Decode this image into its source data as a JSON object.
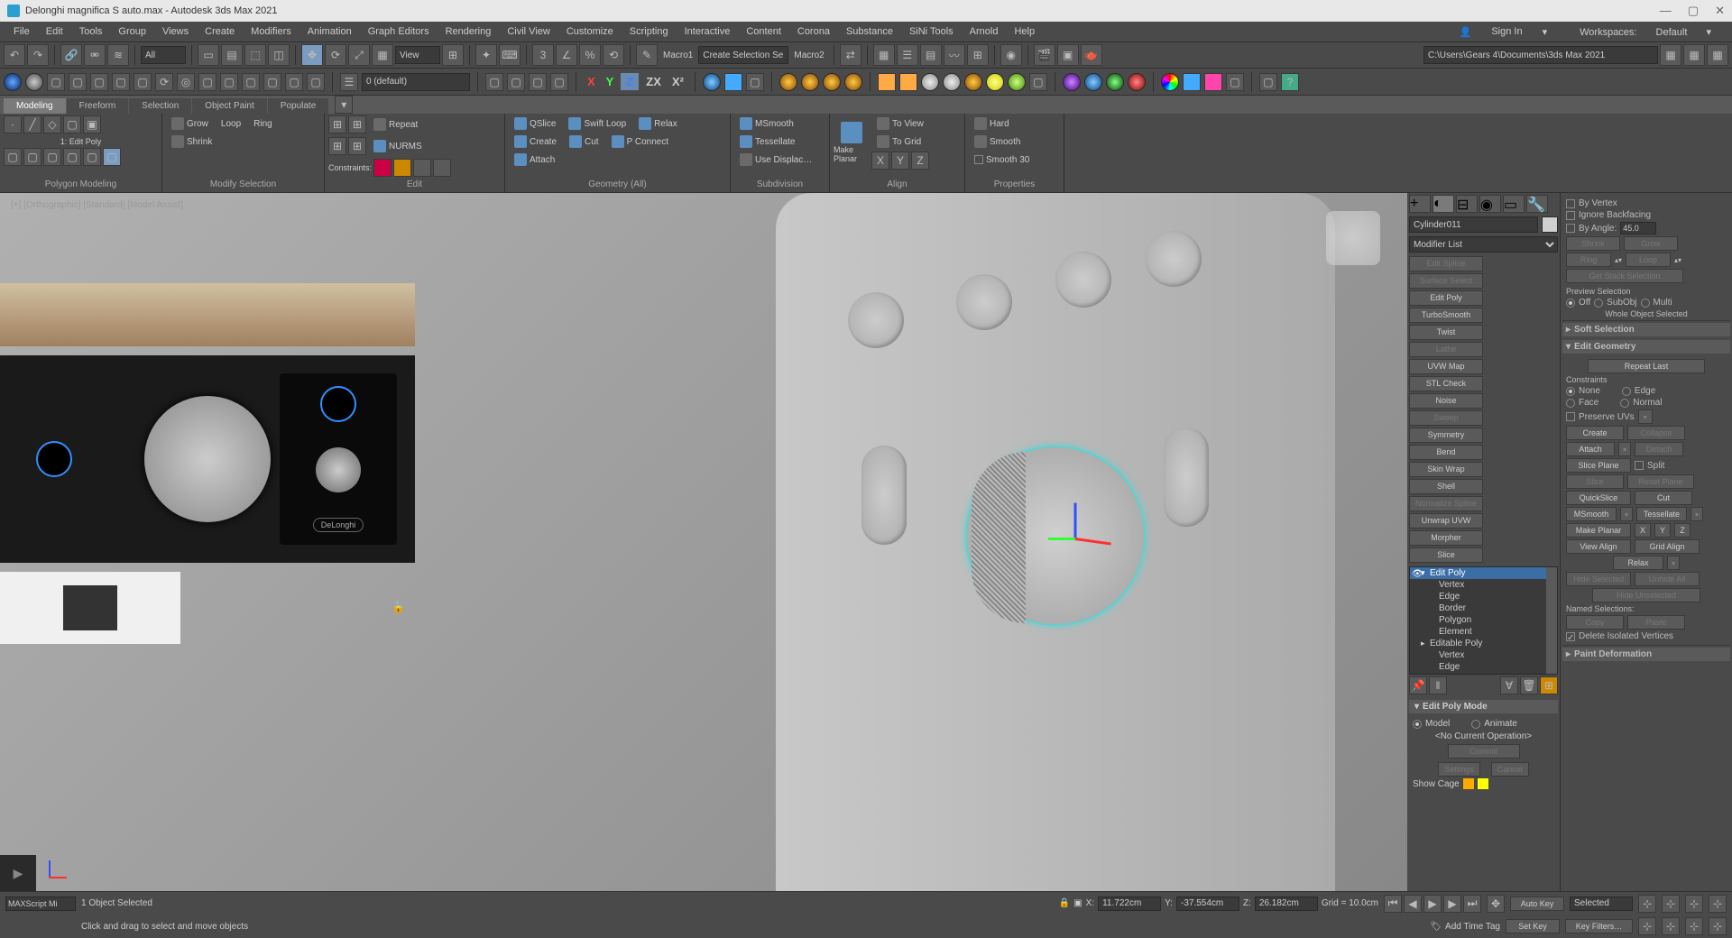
{
  "title": "Delonghi magnifica S auto.max - Autodesk 3ds Max 2021",
  "menus": [
    "File",
    "Edit",
    "Tools",
    "Group",
    "Views",
    "Create",
    "Modifiers",
    "Animation",
    "Graph Editors",
    "Rendering",
    "Civil View",
    "Customize",
    "Scripting",
    "Interactive",
    "Content",
    "Corona",
    "Substance",
    "SiNi Tools",
    "Arnold",
    "Help"
  ],
  "signin": "Sign In",
  "workspaces_label": "Workspaces:",
  "workspaces_value": "Default",
  "toolbar1": {
    "all": "All",
    "view": "View",
    "selection_set": "Create Selection Se",
    "macro1": "Macro1",
    "macro2": "Macro2",
    "path": "C:\\Users\\Gears 4\\Documents\\3ds Max 2021"
  },
  "toolbar2": {
    "obj_layer": "0 (default)"
  },
  "ribbon_tabs": [
    "Modeling",
    "Freeform",
    "Selection",
    "Object Paint",
    "Populate"
  ],
  "ribbon": {
    "polygon_modeling": "Polygon Modeling",
    "modify_selection": "Modify Selection",
    "edit": "Edit",
    "geometry": "Geometry (All)",
    "subdivision": "Subdivision",
    "align": "Align",
    "properties": "Properties",
    "edit_poly_label": "1: Edit Poly",
    "grow": "Grow",
    "shrink": "Shrink",
    "loop": "Loop",
    "ring": "Ring",
    "repeat": "Repeat",
    "nurms": "NURMS",
    "constraints": "Constraints:",
    "qslice": "QSlice",
    "cut": "Cut",
    "swift_loop": "Swift Loop",
    "p_connect": "P Connect",
    "paint_connect": "P Connect",
    "relax": "Relax",
    "attach": "Attach",
    "create": "Create",
    "msmooth": "MSmooth",
    "tessellate": "Tessellate",
    "use_displace": "Use Displac…",
    "make_planar": "Make Planar",
    "to_view": "To View",
    "to_grid": "To Grid",
    "hard": "Hard",
    "smooth": "Smooth",
    "smooth30": "Smooth 30",
    "x": "X",
    "y": "Y",
    "z": "Z"
  },
  "viewport_label": "[+] [Orthographic] [Standard] [Model Assist]",
  "cmd": {
    "object_name": "Cylinder011",
    "modifier_list": "Modifier List",
    "mods": {
      "edit_spline": "Edit Spline",
      "surface_select": "Surface Select",
      "edit_poly": "Edit Poly",
      "turbosmooth": "TurboSmooth",
      "twist": "Twist",
      "lathe": "Lathe",
      "uvw_map": "UVW Map",
      "stl_check": "STL Check",
      "noise": "Noise",
      "sweep": "Sweep",
      "symmetry": "Symmetry",
      "bend": "Bend",
      "skin_wrap": "Skin Wrap",
      "shell": "Shell",
      "normalize_spline": "Normalize Spline",
      "unwrap_uvw": "Unwrap UVW",
      "morpher": "Morpher",
      "slice": "Slice"
    },
    "stack": [
      "Edit Poly",
      "Vertex",
      "Edge",
      "Border",
      "Polygon",
      "Element",
      "Editable Poly",
      "Vertex",
      "Edge"
    ],
    "edit_poly_mode": "Edit Poly Mode",
    "model": "Model",
    "animate": "Animate",
    "no_current_op": "<No Current Operation>",
    "commit": "Commit",
    "settings": "Settings",
    "cancel": "Cancel",
    "show_cage": "Show Cage"
  },
  "right": {
    "by_vertex": "By Vertex",
    "ignore_backfacing": "Ignore Backfacing",
    "by_angle": "By Angle:",
    "by_angle_val": "45.0",
    "shrink": "Shrink",
    "grow": "Grow",
    "ring": "Ring",
    "loop": "Loop",
    "get_stack_sel": "Get Stack Selection",
    "preview_selection": "Preview Selection",
    "off": "Off",
    "subobj": "SubObj",
    "multi": "Multi",
    "whole_object": "Whole Object Selected",
    "soft_selection": "Soft Selection",
    "edit_geometry": "Edit Geometry",
    "repeat_last": "Repeat Last",
    "constraints": "Constraints",
    "none": "None",
    "edge": "Edge",
    "face": "Face",
    "normal": "Normal",
    "preserve_uvs": "Preserve UVs",
    "create": "Create",
    "collapse": "Collapse",
    "attach": "Attach",
    "detach": "Detach",
    "slice_plane": "Slice Plane",
    "split": "Split",
    "slice": "Slice",
    "reset_plane": "Reset Plane",
    "quickslice": "QuickSlice",
    "cut": "Cut",
    "msmooth": "MSmooth",
    "tessellate": "Tessellate",
    "make_planar": "Make Planar",
    "x": "X",
    "y": "Y",
    "z": "Z",
    "view_align": "View Align",
    "grid_align": "Grid Align",
    "relax": "Relax",
    "hide_selected": "Hide Selected",
    "unhide_all": "Unhide All",
    "hide_unselected": "Hide Unselected",
    "named_selections": "Named Selections:",
    "copy": "Copy",
    "paste": "Paste",
    "delete_isolated": "Delete Isolated Vertices",
    "paint_deformation": "Paint Deformation"
  },
  "status": {
    "maxscript": "MAXScript Mi",
    "selected": "1 Object Selected",
    "hint": "Click and drag to select and move objects",
    "x": "X:",
    "xv": "11.722cm",
    "y": "Y:",
    "yv": "-37.554cm",
    "z": "Z:",
    "zv": "26.182cm",
    "grid": "Grid = 10.0cm",
    "auto_key": "Auto Key",
    "selected_btn": "Selected",
    "set_key": "Set Key",
    "key_filters": "Key Filters…",
    "add_time_tag": "Add Time Tag"
  }
}
